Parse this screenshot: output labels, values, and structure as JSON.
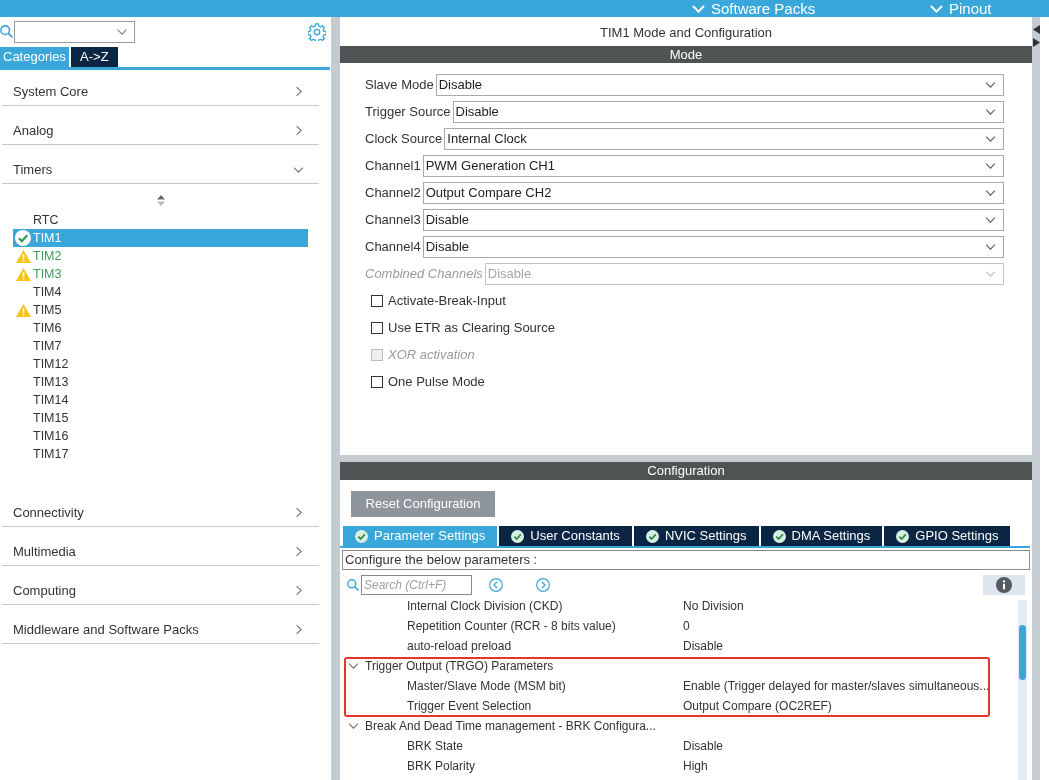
{
  "top_bar": {
    "menus": [
      {
        "label": "Software Packs"
      },
      {
        "label": "Pinout"
      }
    ]
  },
  "sidebar": {
    "tabs": [
      {
        "label": "Categories",
        "selected": true
      },
      {
        "label": "A->Z",
        "selected": false
      }
    ],
    "categories": [
      {
        "label": "System Core",
        "expanded": false
      },
      {
        "label": "Analog",
        "expanded": false
      },
      {
        "label": "Timers",
        "expanded": true,
        "children": [
          {
            "label": "RTC",
            "kind": "plain",
            "selected": false
          },
          {
            "label": "TIM1",
            "kind": "ok",
            "selected": true
          },
          {
            "label": "TIM2",
            "kind": "warning",
            "color": "#3a9d5d",
            "selected": false
          },
          {
            "label": "TIM3",
            "kind": "warning",
            "color": "#3a9d5d",
            "selected": false
          },
          {
            "label": "TIM4",
            "kind": "plain",
            "selected": false
          },
          {
            "label": "TIM5",
            "kind": "warning",
            "selected": false
          },
          {
            "label": "TIM6",
            "kind": "plain",
            "selected": false
          },
          {
            "label": "TIM7",
            "kind": "plain",
            "selected": false
          },
          {
            "label": "TIM12",
            "kind": "plain",
            "selected": false
          },
          {
            "label": "TIM13",
            "kind": "plain",
            "selected": false
          },
          {
            "label": "TIM14",
            "kind": "plain",
            "selected": false
          },
          {
            "label": "TIM15",
            "kind": "plain",
            "selected": false
          },
          {
            "label": "TIM16",
            "kind": "plain",
            "selected": false
          },
          {
            "label": "TIM17",
            "kind": "plain",
            "selected": false
          }
        ]
      },
      {
        "label": "Connectivity",
        "expanded": false
      },
      {
        "label": "Multimedia",
        "expanded": false
      },
      {
        "label": "Computing",
        "expanded": false
      },
      {
        "label": "Middleware and Software Packs",
        "expanded": false
      }
    ]
  },
  "mode_panel": {
    "title": "TIM1 Mode and Configuration",
    "header": "Mode",
    "fields": [
      {
        "label": "Slave Mode",
        "value": "Disable",
        "disabled": false
      },
      {
        "label": "Trigger Source",
        "value": "Disable",
        "disabled": false
      },
      {
        "label": "Clock Source",
        "value": "Internal Clock",
        "disabled": false
      },
      {
        "label": "Channel1",
        "value": "PWM Generation CH1",
        "disabled": false
      },
      {
        "label": "Channel2",
        "value": "Output Compare CH2",
        "disabled": false
      },
      {
        "label": "Channel3",
        "value": "Disable",
        "disabled": false
      },
      {
        "label": "Channel4",
        "value": "Disable",
        "disabled": false
      },
      {
        "label": "Combined Channels",
        "value": "Disable",
        "disabled": true
      }
    ],
    "checkboxes": [
      {
        "label": "Activate-Break-Input",
        "checked": false,
        "disabled": false
      },
      {
        "label": "Use ETR as Clearing Source",
        "checked": false,
        "disabled": false
      },
      {
        "label": "XOR activation",
        "checked": false,
        "disabled": true
      },
      {
        "label": "One Pulse Mode",
        "checked": false,
        "disabled": false
      }
    ]
  },
  "configuration": {
    "header": "Configuration",
    "reset_button": "Reset Configuration",
    "tabs": [
      {
        "label": "Parameter Settings",
        "valid": true,
        "selected": true
      },
      {
        "label": "User Constants",
        "valid": true,
        "selected": false
      },
      {
        "label": "NVIC Settings",
        "valid": true,
        "selected": false
      },
      {
        "label": "DMA Settings",
        "valid": true,
        "selected": false
      },
      {
        "label": "GPIO Settings",
        "valid": true,
        "selected": false
      }
    ],
    "hint": "Configure the below parameters :",
    "search": {
      "placeholder": "Search (Ctrl+F)"
    },
    "parameters": [
      {
        "kind": "param",
        "name": "Internal Clock Division (CKD)",
        "value": "No Division"
      },
      {
        "kind": "param",
        "name": "Repetition Counter (RCR - 8 bits value)",
        "value": "0"
      },
      {
        "kind": "param",
        "name": "auto-reload preload",
        "value": "Disable"
      },
      {
        "kind": "group",
        "name": "Trigger Output (TRGO) Parameters",
        "expanded": true,
        "highlighted": true,
        "children": [
          {
            "kind": "param",
            "name": "Master/Slave Mode (MSM bit)",
            "value": "Enable (Trigger delayed for master/slaves simultaneous..."
          },
          {
            "kind": "param",
            "name": "Trigger Event Selection",
            "value": "Output Compare (OC2REF)"
          }
        ]
      },
      {
        "kind": "group",
        "name": "Break And Dead Time management - BRK Configura...",
        "expanded": true,
        "highlighted": false,
        "children": [
          {
            "kind": "param",
            "name": "BRK State",
            "value": "Disable"
          },
          {
            "kind": "param",
            "name": "BRK Polarity",
            "value": "High"
          }
        ]
      }
    ]
  }
}
